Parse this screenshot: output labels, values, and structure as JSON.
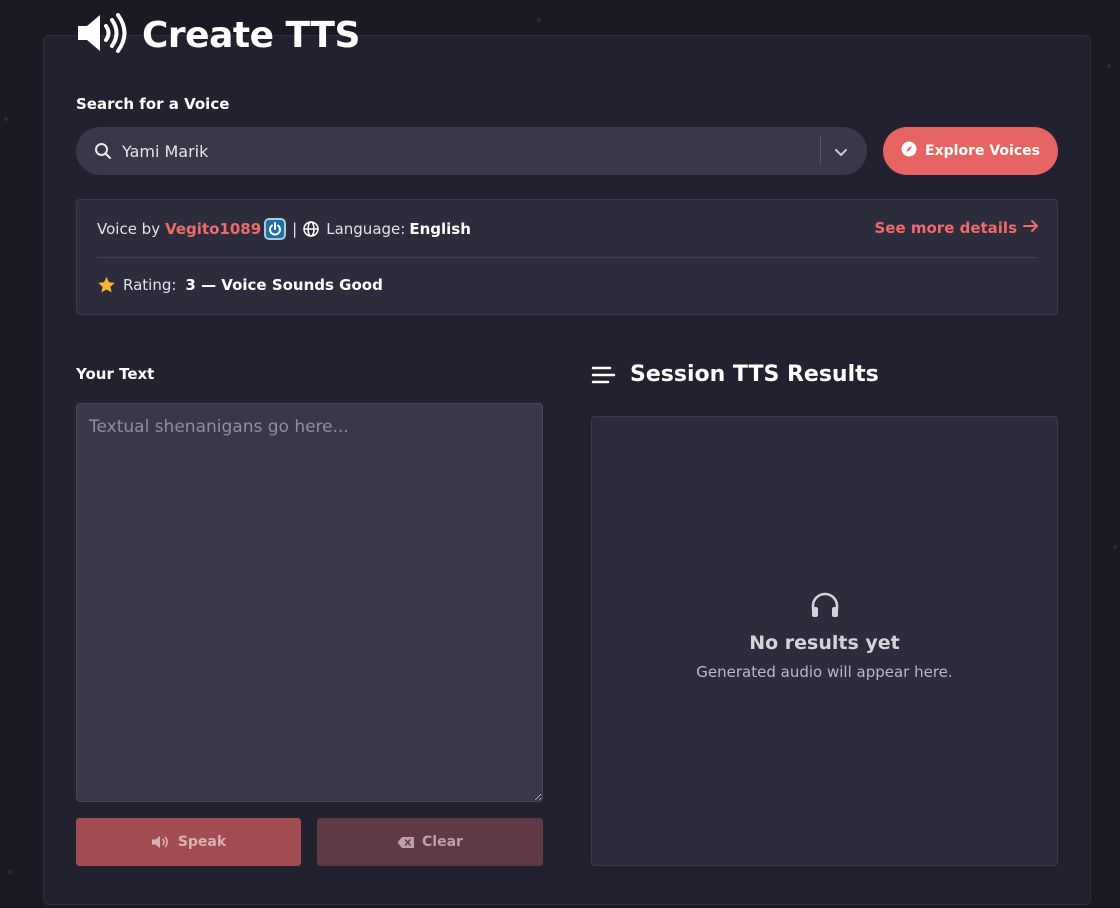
{
  "header": {
    "title": "Create TTS",
    "icon": "speaker-volume-icon"
  },
  "search": {
    "label": "Search for a Voice",
    "value": "Yami Marik",
    "icon": "search-icon",
    "dropdown_icon": "chevron-down-icon"
  },
  "explore_button": {
    "label": "Explore Voices",
    "icon": "compass-icon",
    "color": "#e66563"
  },
  "voice": {
    "by_prefix": "Voice by",
    "author": "Vegito1089",
    "badge_icon": "power-badge-icon",
    "separator": "|",
    "language_label": "Language:",
    "language": "English",
    "details_link": "See more details",
    "rating_label": "Rating:",
    "rating_value": "3 — Voice Sounds Good"
  },
  "text_input": {
    "label": "Your Text",
    "placeholder": "Textual shenanigans go here...",
    "value": ""
  },
  "buttons": {
    "speak": "Speak",
    "clear": "Clear"
  },
  "results": {
    "title": "Session TTS Results",
    "empty_title": "No results yet",
    "empty_subtitle": "Generated audio will appear here."
  },
  "colors": {
    "accent": "#ef6b6b",
    "background": "#1a1a24",
    "panel": "#212130",
    "star": "#f5b630"
  }
}
